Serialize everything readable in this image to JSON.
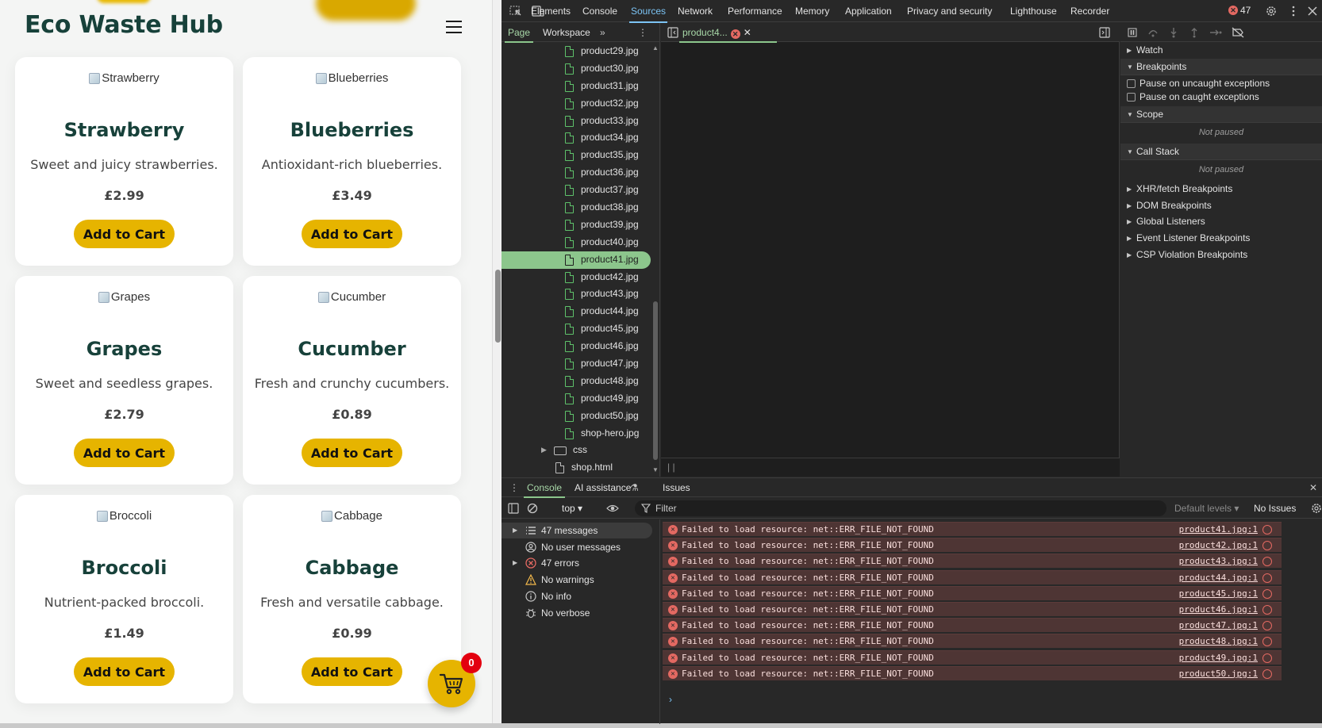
{
  "site": {
    "title": "Eco Waste Hub",
    "cart_count": "0",
    "products": [
      {
        "alt": "Strawberry",
        "name": "Strawberry",
        "desc": "Sweet and juicy strawberries.",
        "price": "£2.99",
        "button": "Add to Cart"
      },
      {
        "alt": "Blueberries",
        "name": "Blueberries",
        "desc": "Antioxidant-rich blueberries.",
        "price": "£3.49",
        "button": "Add to Cart"
      },
      {
        "alt": "Grapes",
        "name": "Grapes",
        "desc": "Sweet and seedless grapes.",
        "price": "£2.79",
        "button": "Add to Cart"
      },
      {
        "alt": "Cucumber",
        "name": "Cucumber",
        "desc": "Fresh and crunchy cucumbers.",
        "price": "£0.89",
        "button": "Add to Cart"
      },
      {
        "alt": "Broccoli",
        "name": "Broccoli",
        "desc": "Nutrient-packed broccoli.",
        "price": "£1.49",
        "button": "Add to Cart"
      },
      {
        "alt": "Cabbage",
        "name": "Cabbage",
        "desc": "Fresh and versatile cabbage.",
        "price": "£0.99",
        "button": "Add to Cart"
      }
    ],
    "colors": {
      "accent": "#e6b400",
      "title": "#17413a",
      "badge": "#e3000f"
    }
  },
  "devtools": {
    "tabs": [
      "Elements",
      "Console",
      "Sources",
      "Network",
      "Performance",
      "Memory",
      "Application",
      "Privacy and security",
      "Lighthouse",
      "Recorder"
    ],
    "active_tab": "Sources",
    "error_count": "47",
    "sources": {
      "nav_tabs": [
        "Page",
        "Workspace"
      ],
      "files": [
        "product29.jpg",
        "product30.jpg",
        "product31.jpg",
        "product32.jpg",
        "product33.jpg",
        "product34.jpg",
        "product35.jpg",
        "product36.jpg",
        "product37.jpg",
        "product38.jpg",
        "product39.jpg",
        "product40.jpg",
        "product41.jpg",
        "product42.jpg",
        "product43.jpg",
        "product44.jpg",
        "product45.jpg",
        "product46.jpg",
        "product47.jpg",
        "product48.jpg",
        "product49.jpg",
        "product50.jpg",
        "shop-hero.jpg"
      ],
      "selected_file": "product41.jpg",
      "folder": "css",
      "html_file": "shop.html",
      "editor_tab": "product4..."
    },
    "debugger": {
      "watch": "Watch",
      "breakpoints": "Breakpoints",
      "pause_uncaught": "Pause on uncaught exceptions",
      "pause_caught": "Pause on caught exceptions",
      "scope": "Scope",
      "not_paused": "Not paused",
      "call_stack": "Call Stack",
      "collapsed_sections": [
        "XHR/fetch Breakpoints",
        "DOM Breakpoints",
        "Global Listeners",
        "Event Listener Breakpoints",
        "CSP Violation Breakpoints"
      ]
    },
    "drawer": {
      "tabs": [
        "Console",
        "AI assistance",
        "Issues"
      ],
      "context": "top",
      "filter_placeholder": "Filter",
      "levels": "Default levels",
      "issues": "No Issues",
      "sidebar": [
        {
          "label": "47 messages",
          "icon": "list-icon"
        },
        {
          "label": "No user messages",
          "icon": "user-icon"
        },
        {
          "label": "47 errors",
          "icon": "error-icon"
        },
        {
          "label": "No warnings",
          "icon": "warning-icon"
        },
        {
          "label": "No info",
          "icon": "info-icon"
        },
        {
          "label": "No verbose",
          "icon": "bug-icon"
        }
      ],
      "messages": [
        {
          "text": "Failed to load resource: net::ERR_FILE_NOT_FOUND",
          "source": "product41.jpg:1"
        },
        {
          "text": "Failed to load resource: net::ERR_FILE_NOT_FOUND",
          "source": "product42.jpg:1"
        },
        {
          "text": "Failed to load resource: net::ERR_FILE_NOT_FOUND",
          "source": "product43.jpg:1"
        },
        {
          "text": "Failed to load resource: net::ERR_FILE_NOT_FOUND",
          "source": "product44.jpg:1"
        },
        {
          "text": "Failed to load resource: net::ERR_FILE_NOT_FOUND",
          "source": "product45.jpg:1"
        },
        {
          "text": "Failed to load resource: net::ERR_FILE_NOT_FOUND",
          "source": "product46.jpg:1"
        },
        {
          "text": "Failed to load resource: net::ERR_FILE_NOT_FOUND",
          "source": "product47.jpg:1"
        },
        {
          "text": "Failed to load resource: net::ERR_FILE_NOT_FOUND",
          "source": "product48.jpg:1"
        },
        {
          "text": "Failed to load resource: net::ERR_FILE_NOT_FOUND",
          "source": "product49.jpg:1"
        },
        {
          "text": "Failed to load resource: net::ERR_FILE_NOT_FOUND",
          "source": "product50.jpg:1"
        }
      ],
      "prompt": "›"
    }
  }
}
